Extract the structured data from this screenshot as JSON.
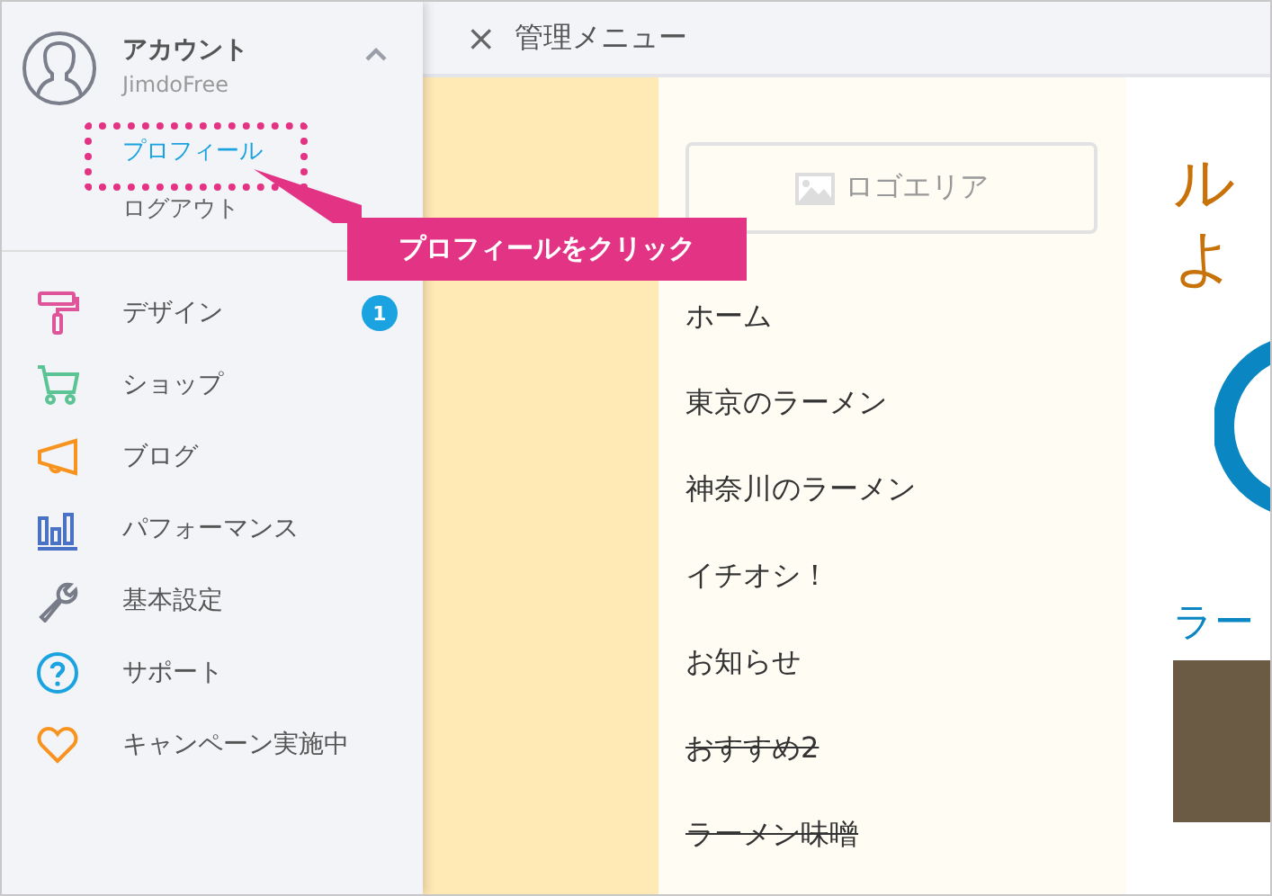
{
  "account": {
    "title": "アカウント",
    "plan": "JimdoFree",
    "expanded": true,
    "links": [
      {
        "label": "プロフィール",
        "selected": true
      },
      {
        "label": "ログアウト",
        "selected": false
      }
    ]
  },
  "sidebar": {
    "items": [
      {
        "label": "デザイン",
        "color": "#e0559a",
        "badge": "1"
      },
      {
        "label": "ショップ",
        "color": "#5cc394"
      },
      {
        "label": "ブログ",
        "color": "#f7931e"
      },
      {
        "label": "パフォーマンス",
        "color": "#4a72c4"
      },
      {
        "label": "基本設定",
        "color": "#777c88"
      },
      {
        "label": "サポート",
        "color": "#1aa3e0"
      },
      {
        "label": "キャンペーン実施中",
        "color": "#f7931e"
      }
    ]
  },
  "callout": {
    "text": "プロフィールをクリック"
  },
  "header": {
    "close": "×",
    "title": "管理メニュー"
  },
  "site": {
    "logo_area": "ロゴエリア",
    "nav": [
      {
        "label": "ホーム",
        "hidden": false
      },
      {
        "label": "東京のラーメン",
        "hidden": false
      },
      {
        "label": "神奈川のラーメン",
        "hidden": false
      },
      {
        "label": "イチオシ！",
        "hidden": false
      },
      {
        "label": "お知らせ",
        "hidden": false
      },
      {
        "label": "おすすめ2",
        "hidden": true
      },
      {
        "label": "ラーメン味噌",
        "hidden": true
      }
    ],
    "title_lines": [
      "ル",
      "よ"
    ],
    "heading": "ラー"
  }
}
